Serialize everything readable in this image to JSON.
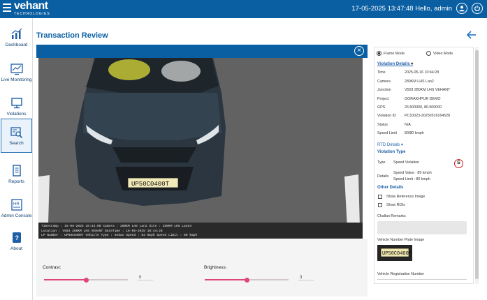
{
  "header": {
    "brand": "vehant",
    "brand_sub": "TECHNOLOGIES",
    "datetime_user": "17-05-2025 13:47:48  Hello, admin",
    "colors": {
      "bar": "#0a5fa3"
    }
  },
  "sidebar": {
    "items": [
      {
        "label": "Dashboard",
        "icon": "chart-icon"
      },
      {
        "label": "Live Monitoring",
        "icon": "monitoring-icon"
      },
      {
        "label": "Violations",
        "icon": "monitor-icon"
      },
      {
        "label": "Search",
        "icon": "search-icon"
      },
      {
        "label": "Reports",
        "icon": "reports-icon"
      },
      {
        "label": "Admin Console",
        "icon": "admin-icon"
      },
      {
        "label": "About",
        "icon": "about-icon"
      }
    ],
    "active": "Search"
  },
  "main": {
    "title": "Transaction Review",
    "overlay_lines": [
      "Timestamp : 15-05-2025 10:44:00   Camera : 280KM LHS Lan2   Site : 280KM LHS Lane3",
      "Location : V503 280KM LHS VEHANT   DateTime : 16-05-2025 10:44:28",
      "LP Number : UP50C0400T   Vehicle Type : Sedan   Speed : 64 Kmph   Speed Limit : 80 kmph"
    ],
    "plate_text": "UP50C0400T",
    "contrast_label": "Contrast:",
    "contrast_value": "0",
    "contrast_level": 0.5,
    "brightness_label": "Brightness:",
    "brightness_value": "3",
    "brightness_level": 0.5
  },
  "panel": {
    "mode_frame": "Frame Mode",
    "mode_video": "Video Mode",
    "violation_details_title": "Violation Details",
    "details": [
      {
        "k": "Time",
        "v": "2025-05-16 10:44:28"
      },
      {
        "k": "Camera",
        "v": "280KM LHS Lan2"
      },
      {
        "k": "Junction",
        "v": "V503 280KM LHS VEHANT"
      },
      {
        "k": "Project",
        "v": "GORAKHPUR DEMO"
      },
      {
        "k": "GPS",
        "v": "26.500000, 80.500000"
      },
      {
        "k": "Violation ID",
        "v": "PC10023-20250516164528"
      },
      {
        "k": "Status",
        "v": "N/A"
      },
      {
        "k": "Speed Limit",
        "v": "80/80 kmph"
      }
    ],
    "rtd_details": "RTD Details",
    "violation_type_title": "Violation Type",
    "type_key": "Type",
    "type_value": "Speed Violation",
    "details_key": "Details",
    "speed_value": "Speed Value : 89 kmph",
    "speed_limit": "Speed Limit : 80 kmph",
    "speed_sign": "S",
    "other_details": "Other Details",
    "show_reference": "Show Reference Image",
    "show_rois": "Show ROIs",
    "challan_remarks": "Challan Remarks",
    "plate_image_label": "Vehicle Number Plate Image",
    "reg_number_label": "Vehicle Registration Number"
  }
}
